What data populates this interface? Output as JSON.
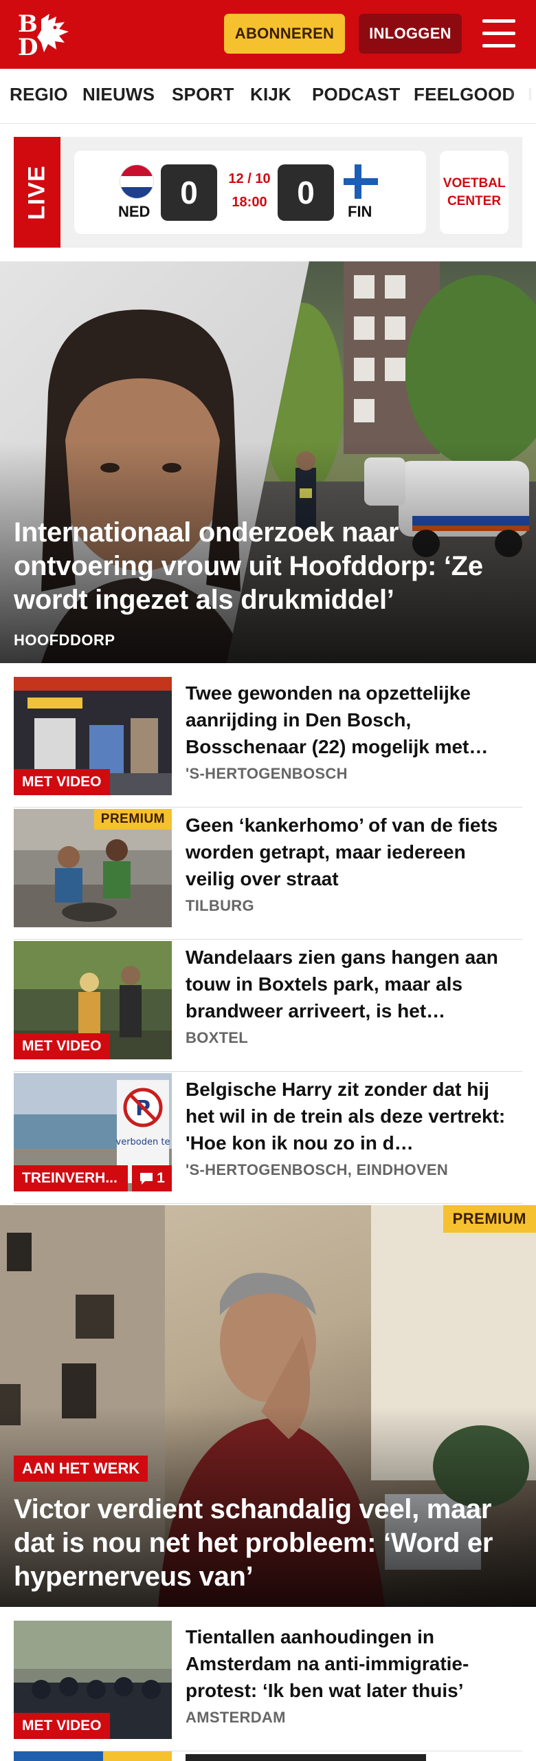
{
  "header": {
    "subscribe_label": "ABONNEREN",
    "login_label": "INLOGGEN",
    "brand_color": "#d10a10",
    "subscribe_color": "#f5c12f",
    "login_color": "#8e0a11",
    "logo_text": "BD"
  },
  "nav": {
    "items": [
      "REGIO",
      "NIEUWS",
      "SPORT",
      "KIJK",
      "PODCAST",
      "FEELGOOD"
    ]
  },
  "live": {
    "label": "LIVE",
    "home_team": "NED",
    "away_team": "FIN",
    "home_score": "0",
    "away_score": "0",
    "date": "12 / 10",
    "time": "18:00",
    "voetbal_center": "VOETBAL CENTER"
  },
  "hero": {
    "title": "Internationaal onderzoek naar ontvoering vrouw uit Hoofddorp: ‘Ze wordt ingezet als drukmiddel’",
    "location": "HOOFDDORP"
  },
  "articles": [
    {
      "title": "Twee gewonden na opzettelijke aanrijding in Den Bosch, Bosschenaar (22) mogelijk met…",
      "location": "'S-HERTOGENBOSCH",
      "badge": "MET VIDEO"
    },
    {
      "title": "Geen ‘kankerhomo’ of van de fiets worden getrapt, maar iedereen veilig over straat",
      "location": "TILBURG",
      "premium": "PREMIUM"
    },
    {
      "title": "Wandelaars zien gans hangen aan touw in Boxtels park, maar als brandweer arriveert, is het…",
      "location": "BOXTEL",
      "badge": "MET VIDEO"
    },
    {
      "title": "Belgische Harry zit zonder dat hij het wil in de trein als deze vertrekt: 'Hoe kon ik nou zo in d…",
      "location": "'S-HERTOGENBOSCH, EINDHOVEN",
      "badge": "TREINVERH...",
      "comments": "1",
      "sign_text": "verboden te"
    }
  ],
  "hero2": {
    "premium": "PREMIUM",
    "tag": "AAN HET WERK",
    "title": "Victor verdient schandalig veel, maar dat is nou net het probleem: ‘Word er hypernerveus van’"
  },
  "article5": {
    "title": "Tientallen aanhoudingen in Amsterdam na anti-immigratie-protest: ‘Ik ben wat later thuis’",
    "location": "AMSTERDAM",
    "badge": "MET VIDEO"
  }
}
